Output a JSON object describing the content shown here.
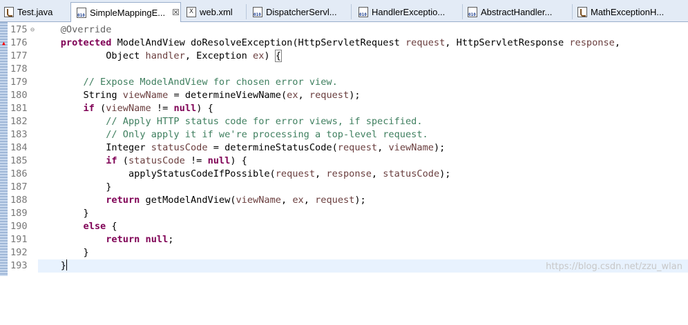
{
  "tabs": [
    {
      "label": "Test.java",
      "icon": "java-file-icon"
    },
    {
      "label": "SimpleMappingE...",
      "icon": "class-file-icon",
      "active": true,
      "close": "☒"
    },
    {
      "label": "web.xml",
      "icon": "xml-file-icon"
    },
    {
      "label": "DispatcherServl...",
      "icon": "class-file-icon"
    },
    {
      "label": "HandlerExceptio...",
      "icon": "class-file-icon"
    },
    {
      "label": "AbstractHandler...",
      "icon": "class-file-icon"
    },
    {
      "label": "MathExceptionH...",
      "icon": "java-file-icon"
    }
  ],
  "editor": {
    "lines": [
      {
        "n": "175",
        "fold": "⊖"
      },
      {
        "n": "176",
        "marker": true
      },
      {
        "n": "177"
      },
      {
        "n": "178"
      },
      {
        "n": "179"
      },
      {
        "n": "180"
      },
      {
        "n": "181"
      },
      {
        "n": "182"
      },
      {
        "n": "183"
      },
      {
        "n": "184"
      },
      {
        "n": "185"
      },
      {
        "n": "186"
      },
      {
        "n": "187"
      },
      {
        "n": "188"
      },
      {
        "n": "189"
      },
      {
        "n": "190"
      },
      {
        "n": "191"
      },
      {
        "n": "192"
      },
      {
        "n": "193",
        "current": true
      }
    ],
    "code": {
      "l175": {
        "annotation": "@Override"
      },
      "l176": {
        "kw": "protected",
        "t1": " ModelAndView doResolveException(HttpServletRequest ",
        "v1": "request",
        "t2": ", HttpServletResponse ",
        "v2": "response",
        "t3": ","
      },
      "l177": {
        "t1": "Object ",
        "v1": "handler",
        "t2": ", Exception ",
        "v2": "ex",
        "t3": ") ",
        "brace": "{"
      },
      "l179": {
        "comment": "// Expose ModelAndView for chosen error view."
      },
      "l180": {
        "t1": "String ",
        "v1": "viewName",
        "t2": " = determineViewName(",
        "v2": "ex",
        "t3": ", ",
        "v3": "request",
        "t4": ");"
      },
      "l181": {
        "kw": "if",
        "t1": " (",
        "v1": "viewName",
        "t2": " != ",
        "kw2": "null",
        "t3": ") {"
      },
      "l182": {
        "comment": "// Apply HTTP status code for error views, if specified."
      },
      "l183": {
        "comment": "// Only apply it if we're processing a top-level request."
      },
      "l184": {
        "t1": "Integer ",
        "v1": "statusCode",
        "t2": " = determineStatusCode(",
        "v2": "request",
        "t3": ", ",
        "v3": "viewName",
        "t4": ");"
      },
      "l185": {
        "kw": "if",
        "t1": " (",
        "v1": "statusCode",
        "t2": " != ",
        "kw2": "null",
        "t3": ") {"
      },
      "l186": {
        "t1": "applyStatusCodeIfPossible(",
        "v1": "request",
        "t2": ", ",
        "v2": "response",
        "t3": ", ",
        "v3": "statusCode",
        "t4": ");"
      },
      "l187": {
        "t1": "}"
      },
      "l188": {
        "kw": "return",
        "t1": " getModelAndView(",
        "v1": "viewName",
        "t2": ", ",
        "v2": "ex",
        "t3": ", ",
        "v3": "request",
        "t4": ");"
      },
      "l189": {
        "t1": "}"
      },
      "l190": {
        "kw": "else",
        "t1": " {"
      },
      "l191": {
        "kw": "return",
        "t1": " ",
        "kw2": "null",
        "t2": ";"
      },
      "l192": {
        "t1": "}"
      },
      "l193": {
        "t1": "}"
      }
    }
  },
  "watermark": "https://blog.csdn.net/zzu_wlan",
  "colors": {
    "keyword": "#7f0055",
    "comment": "#3f7f5f",
    "annotation": "#646464",
    "variable": "#6a3e3e",
    "current_line": "#e8f2fe",
    "tab_bar": "#e3ebf6"
  }
}
